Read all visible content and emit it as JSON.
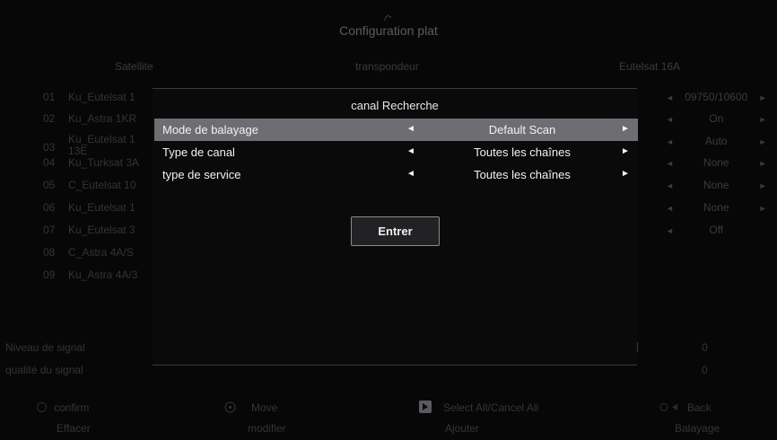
{
  "title": "Configuration plat",
  "headers": {
    "satellite": "Satellite",
    "transponder": "transpondeur",
    "satellite_value": "Eutelsat 16A"
  },
  "satellites": [
    {
      "num": "01",
      "name": "Ku_Eutelsat 1"
    },
    {
      "num": "02",
      "name": "Ku_Astra 1KR"
    },
    {
      "num": "03",
      "name": "Ku_Eutelsat 1 13E"
    },
    {
      "num": "04",
      "name": "Ku_Turksat 3A"
    },
    {
      "num": "05",
      "name": "C_Eutelsat 10"
    },
    {
      "num": "06",
      "name": "Ku_Eutelsat 1"
    },
    {
      "num": "07",
      "name": "Ku_Eutelsat 3"
    },
    {
      "num": "08",
      "name": "C_Astra 4A/S"
    },
    {
      "num": "09",
      "name": "Ku_Astra 4A/3"
    }
  ],
  "right_params": [
    {
      "left": "◄",
      "value": "09750/10600",
      "right": "►"
    },
    {
      "left": "◄",
      "value": "On",
      "right": "►"
    },
    {
      "left": "◄",
      "value": "Auto",
      "right": "►"
    },
    {
      "left": "◄",
      "value": "None",
      "right": "►"
    },
    {
      "left": "◄",
      "value": "None",
      "right": "►"
    },
    {
      "left": "◄",
      "value": "None",
      "right": "►"
    },
    {
      "left": "◄",
      "value": "Off",
      "right": "►"
    }
  ],
  "signal": {
    "level_label": "Niveau de signal",
    "level_value": "0",
    "quality_label": "qualité du signal",
    "quality_value": "0"
  },
  "footer": {
    "confirm": "confirm",
    "move": "Move",
    "select_all": "Select All/Cancel All",
    "back": "Back",
    "erase": "Effacer",
    "modify": "modifier",
    "add": "Ajouter",
    "scan": "Balayage"
  },
  "dialog": {
    "title": "canal Recherche",
    "rows": [
      {
        "label": "Mode de balayage",
        "left": "◄",
        "value": "Default Scan",
        "right": "►"
      },
      {
        "label": "Type de canal",
        "left": "◄",
        "value": "Toutes les chaînes",
        "right": "►"
      },
      {
        "label": "type de service",
        "left": "◄",
        "value": "Toutes les chaînes",
        "right": "►"
      }
    ],
    "enter_label": "Entrer"
  },
  "colors": {
    "background": "#070708",
    "selected_row": "#6e6e72",
    "dim_text": "#3a3b3e",
    "bright_text": "#f2f2f2"
  }
}
